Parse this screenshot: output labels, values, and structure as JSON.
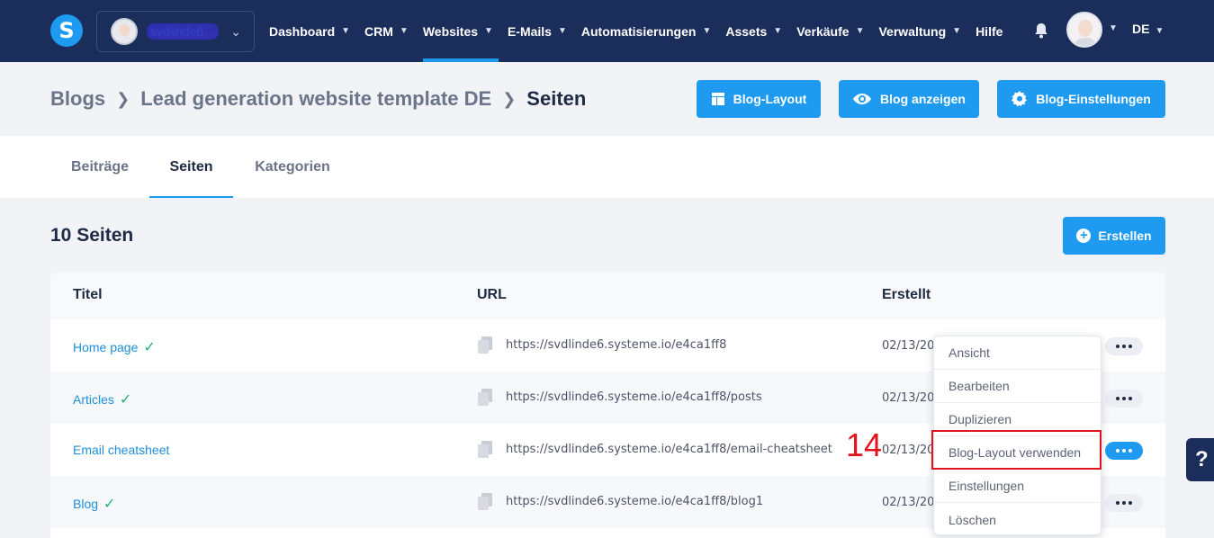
{
  "nav": {
    "logo": "S",
    "account_name": "svdlinde6…",
    "items": [
      {
        "label": "Dashboard",
        "chevron": true,
        "active": false
      },
      {
        "label": "CRM",
        "chevron": true,
        "active": false
      },
      {
        "label": "Websites",
        "chevron": true,
        "active": true
      },
      {
        "label": "E-Mails",
        "chevron": true,
        "active": false
      },
      {
        "label": "Automatisierungen",
        "chevron": true,
        "active": false
      },
      {
        "label": "Assets",
        "chevron": true,
        "active": false
      },
      {
        "label": "Verkäufe",
        "chevron": true,
        "active": false
      },
      {
        "label": "Verwaltung",
        "chevron": true,
        "active": false
      },
      {
        "label": "Hilfe",
        "chevron": false,
        "active": false
      }
    ],
    "language": "DE"
  },
  "breadcrumb": {
    "items": [
      "Blogs",
      "Lead generation website template DE",
      "Seiten"
    ]
  },
  "header_buttons": {
    "layout": "Blog-Layout",
    "view": "Blog anzeigen",
    "settings": "Blog-Einstellungen"
  },
  "tabs": [
    {
      "label": "Beiträge",
      "active": false
    },
    {
      "label": "Seiten",
      "active": true
    },
    {
      "label": "Kategorien",
      "active": false
    }
  ],
  "page_count": "10 Seiten",
  "create_button": "Erstellen",
  "table": {
    "headers": {
      "title": "Titel",
      "url": "URL",
      "created": "Erstellt"
    },
    "rows": [
      {
        "title": "Home page",
        "checked": true,
        "url": "https://svdlinde6.systeme.io/e4ca1ff8",
        "date": "02/13/20"
      },
      {
        "title": "Articles",
        "checked": true,
        "url": "https://svdlinde6.systeme.io/e4ca1ff8/posts",
        "date": "02/13/20"
      },
      {
        "title": "Email cheatsheet",
        "checked": false,
        "url": "https://svdlinde6.systeme.io/e4ca1ff8/email-cheatsheet",
        "date": "02/13/20"
      },
      {
        "title": "Blog",
        "checked": true,
        "url": "https://svdlinde6.systeme.io/e4ca1ff8/blog1",
        "date": "02/13/20"
      }
    ]
  },
  "dropdown": {
    "items": [
      "Ansicht",
      "Bearbeiten",
      "Duplizieren",
      "Blog-Layout verwenden",
      "Einstellungen",
      "Löschen"
    ]
  },
  "annotation": "14",
  "help_button": "?",
  "colors": {
    "nav_bg": "#1b2d5b",
    "accent": "#1e9bf0",
    "success": "#23b26d",
    "annotation": "#e0141e"
  }
}
